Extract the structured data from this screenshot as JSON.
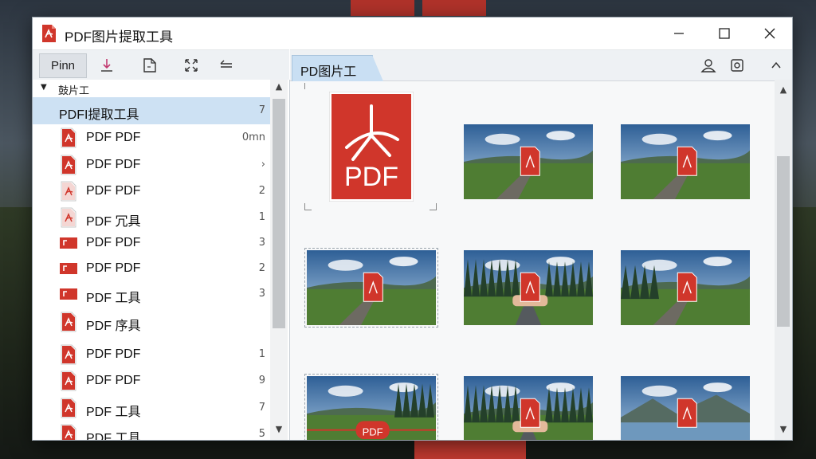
{
  "window": {
    "title": "PDF图片提取工具",
    "accent_red": "#d0362b",
    "selection_blue": "#cde1f3"
  },
  "toolbar": {
    "pin_label": "Pinn",
    "icons": [
      "download-icon",
      "document-icon",
      "expand-icon",
      "back-arrow-icon"
    ]
  },
  "tree": {
    "header": "鼓片工",
    "selected": {
      "label": "PDFI提取工具",
      "count": "7"
    },
    "items": [
      {
        "label": "PDF PDF",
        "count": "0mn"
      },
      {
        "label": "PDF PDF",
        "count": "›"
      },
      {
        "label": "PDF PDF",
        "count": "2"
      },
      {
        "label": "PDF 冗具",
        "count": "1"
      },
      {
        "label": "PDF PDF",
        "count": "3"
      },
      {
        "label": "PDF PDF",
        "count": "2"
      },
      {
        "label": "PDF 工具",
        "count": "3"
      },
      {
        "label": "PDF 序具",
        "count": ""
      },
      {
        "label": "PDF PDF",
        "count": "1"
      },
      {
        "label": "PDF PDF",
        "count": "9"
      },
      {
        "label": "PDF 工具",
        "count": "7"
      },
      {
        "label": "PDF 工具",
        "count": "5"
      }
    ]
  },
  "content": {
    "tab_label": "PD图片工",
    "pdf_logo_text": "PDF",
    "banner_text": "PDF",
    "icons": [
      "user-icon",
      "settings-refresh-icon",
      "collapse-up-icon"
    ]
  }
}
